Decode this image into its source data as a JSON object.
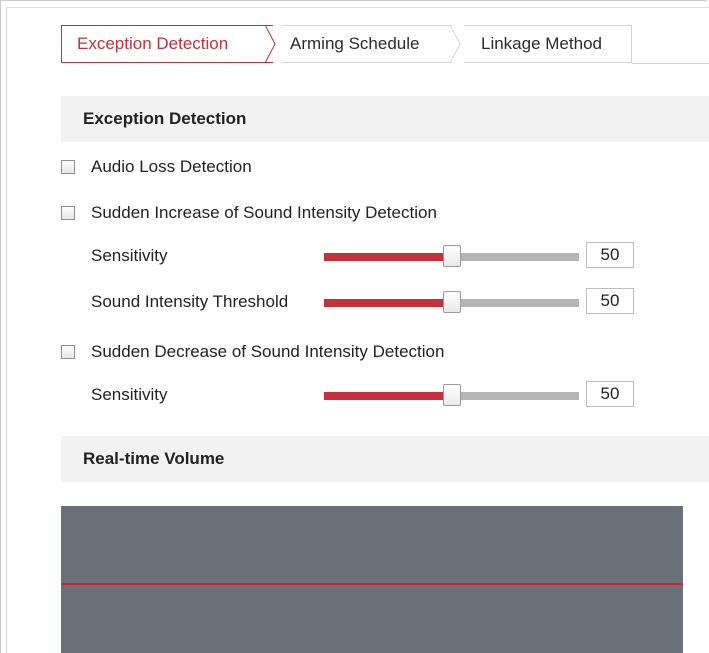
{
  "tabs": [
    {
      "label": "Exception Detection",
      "active": true
    },
    {
      "label": "Arming Schedule",
      "active": false
    },
    {
      "label": "Linkage Method",
      "active": false
    }
  ],
  "exception_section": {
    "title": "Exception Detection",
    "audio_loss": {
      "label": "Audio Loss Detection",
      "checked": false
    },
    "sudden_increase": {
      "label": "Sudden Increase of Sound Intensity Detection",
      "checked": false,
      "sensitivity": {
        "label": "Sensitivity",
        "value": "50",
        "level_percent": 50
      },
      "threshold": {
        "label": "Sound Intensity Threshold",
        "value": "50",
        "level_percent": 50
      }
    },
    "sudden_decrease": {
      "label": "Sudden Decrease of Sound Intensity Detection",
      "checked": false,
      "sensitivity": {
        "label": "Sensitivity",
        "value": "50",
        "level_percent": 50
      }
    }
  },
  "volume_section": {
    "title": "Real-time Volume"
  },
  "colors": {
    "accent": "#c6303a",
    "track": "#b5b5b5",
    "panel": "#6a7078",
    "header_bg": "#f2f2f2"
  }
}
